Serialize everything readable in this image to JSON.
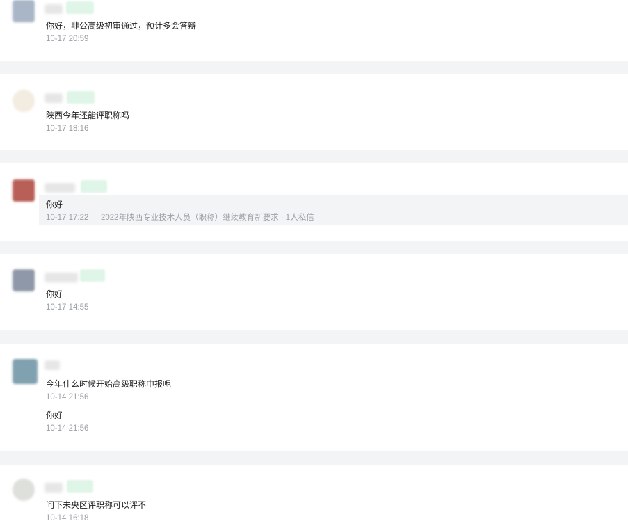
{
  "messages": [
    {
      "text": "你好，非公高级初审通过，预计多会答辩",
      "time": "10-17 20:59"
    },
    {
      "text": "陕西今年还能评职称吗",
      "time": "10-17 18:16"
    },
    {
      "text": "你好",
      "time": "10-17 17:22",
      "source": "2022年陕西专业技术人员（职称）继续教育新要求 · 1人私信"
    },
    {
      "text": "你好",
      "time": "10-17 14:55"
    },
    {
      "text": "今年什么时候开始高级职称申报呢",
      "time": "10-14 21:56",
      "followup_text": "你好",
      "followup_time": "10-14 21:56"
    },
    {
      "text": "问下未央区评职称可以评不",
      "time": "10-14 16:18"
    }
  ],
  "colors": {
    "page_background": "#f3f4f6",
    "card_background": "#ffffff",
    "meta_text": "#9aa0a6",
    "badge_background": "#dff5e7"
  }
}
